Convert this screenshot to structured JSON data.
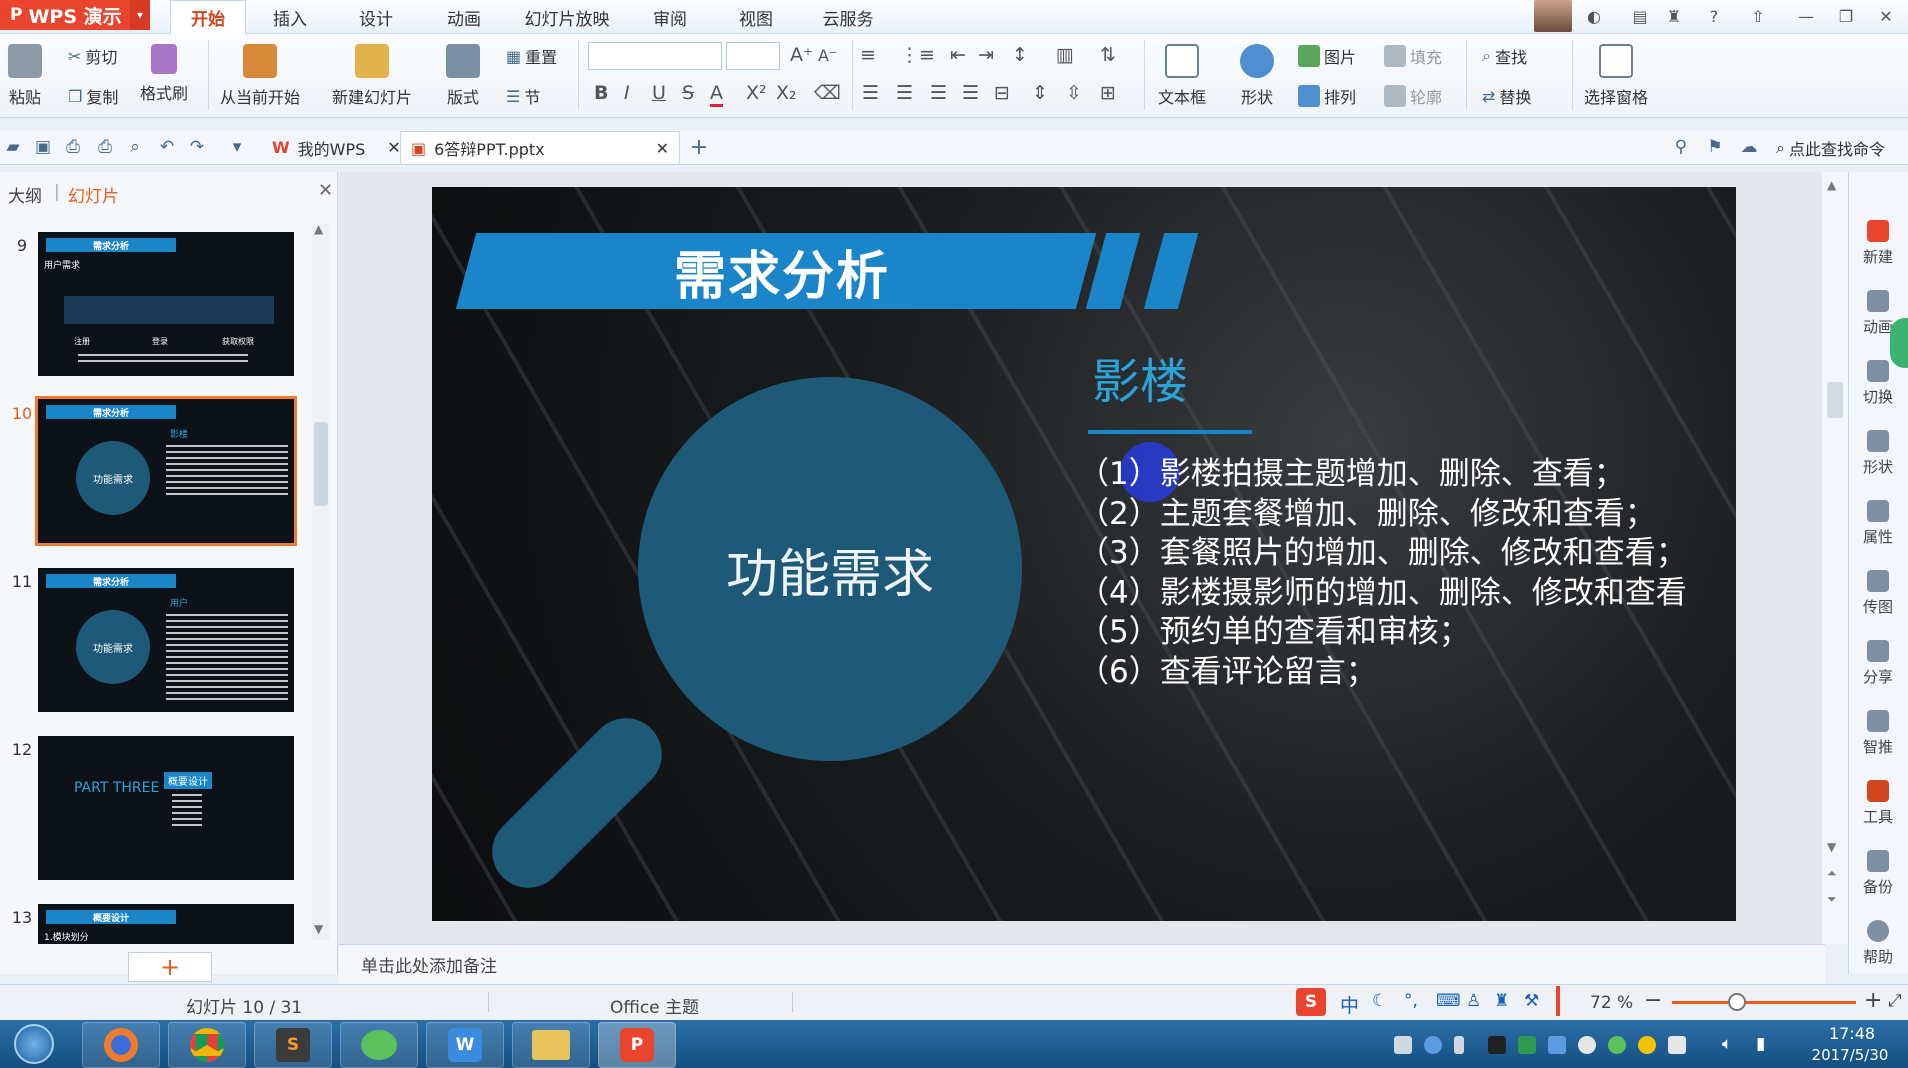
{
  "titlebar": {
    "app_name": "WPS 演示",
    "menu_tabs": [
      "开始",
      "插入",
      "设计",
      "动画",
      "幻灯片放映",
      "审阅",
      "视图",
      "云服务"
    ],
    "active_tab": "开始"
  },
  "ribbon": {
    "paste": "粘贴",
    "cut": "剪切",
    "copy": "复制",
    "format_painter": "格式刷",
    "from_current": "从当前开始",
    "new_slide": "新建幻灯片",
    "layout": "版式",
    "reset": "重置",
    "section": "节",
    "bold": "B",
    "italic": "I",
    "underline": "U",
    "strike": "S",
    "font_color": "A",
    "superscript": "X²",
    "subscript": "X₂",
    "textbox": "文本框",
    "shape": "形状",
    "picture": "图片",
    "fill": "填充",
    "arrange": "排列",
    "outline": "轮廓",
    "find": "查找",
    "replace": "替换",
    "select_pane": "选择窗格"
  },
  "tabs_bar": {
    "tab1": "我的WPS",
    "tab2": "6答辩PPT.pptx",
    "search": "点此查找命令"
  },
  "left_panel": {
    "outline_tab": "大纲",
    "slides_tab": "幻灯片",
    "thumbs": [
      {
        "num": "9",
        "title": "需求分析",
        "sub": "用户需求",
        "labels": [
          "注册",
          "登录",
          "获取权限"
        ]
      },
      {
        "num": "10",
        "title": "需求分析",
        "sub": "影楼",
        "circle": "功能需求"
      },
      {
        "num": "11",
        "title": "需求分析",
        "sub": "用户",
        "circle": "功能需求"
      },
      {
        "num": "12",
        "part": "PART THREE",
        "box": "概要设计"
      },
      {
        "num": "13",
        "title": "概要设计",
        "sub": "1.模块划分"
      }
    ],
    "add": "+"
  },
  "slide": {
    "title": "需求分析",
    "circle_label": "功能需求",
    "subtitle": "影楼",
    "items": [
      "（1）影楼拍摄主题增加、删除、查看；",
      "（2）主题套餐增加、删除、修改和查看；",
      "（3）套餐照片的增加、删除、修改和查看；",
      "（4）影楼摄影师的增加、删除、修改和查看",
      "（5）预约单的查看和审核；",
      "（6）查看评论留言；"
    ]
  },
  "notes": {
    "placeholder": "单击此处添加备注"
  },
  "right_bar": [
    "新建",
    "动画",
    "切换",
    "形状",
    "属性",
    "传图",
    "分享",
    "智推",
    "工具",
    "备份",
    "帮助"
  ],
  "status": {
    "slide_counter": "幻灯片 10 / 31",
    "theme": "Office 主题",
    "zoom": "72 %",
    "ime": "中",
    "zoom_minus": "−",
    "zoom_plus": "+"
  },
  "taskbar": {
    "time": "17:48",
    "date": "2017/5/30"
  },
  "colors": {
    "slide_blue": "#1a86c9",
    "circle_teal": "#1e5a78",
    "subtitle_blue": "#2aa3d8",
    "wps_red": "#e9442e",
    "thumb_selected": "#f07b2f"
  }
}
